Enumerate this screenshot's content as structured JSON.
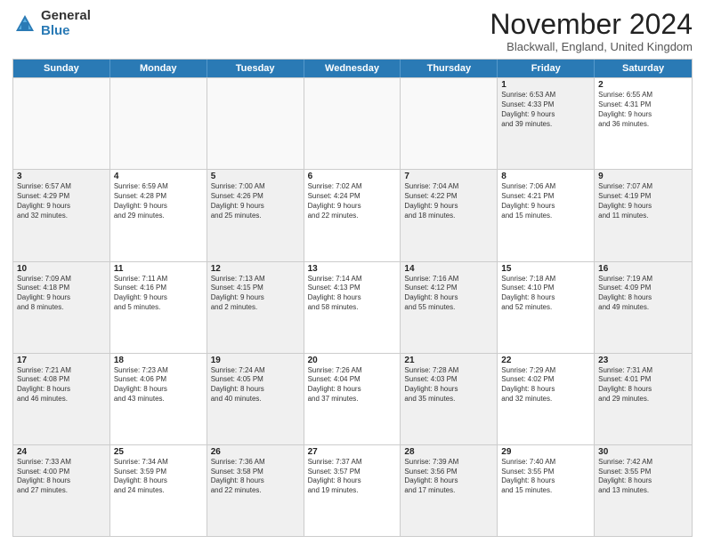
{
  "logo": {
    "general": "General",
    "blue": "Blue"
  },
  "header": {
    "month": "November 2024",
    "location": "Blackwall, England, United Kingdom"
  },
  "weekdays": [
    "Sunday",
    "Monday",
    "Tuesday",
    "Wednesday",
    "Thursday",
    "Friday",
    "Saturday"
  ],
  "rows": [
    [
      {
        "day": "",
        "text": "",
        "empty": true
      },
      {
        "day": "",
        "text": "",
        "empty": true
      },
      {
        "day": "",
        "text": "",
        "empty": true
      },
      {
        "day": "",
        "text": "",
        "empty": true
      },
      {
        "day": "",
        "text": "",
        "empty": true
      },
      {
        "day": "1",
        "text": "Sunrise: 6:53 AM\nSunset: 4:33 PM\nDaylight: 9 hours\nand 39 minutes.",
        "shaded": true
      },
      {
        "day": "2",
        "text": "Sunrise: 6:55 AM\nSunset: 4:31 PM\nDaylight: 9 hours\nand 36 minutes.",
        "shaded": false
      }
    ],
    [
      {
        "day": "3",
        "text": "Sunrise: 6:57 AM\nSunset: 4:29 PM\nDaylight: 9 hours\nand 32 minutes.",
        "shaded": true
      },
      {
        "day": "4",
        "text": "Sunrise: 6:59 AM\nSunset: 4:28 PM\nDaylight: 9 hours\nand 29 minutes.",
        "shaded": false
      },
      {
        "day": "5",
        "text": "Sunrise: 7:00 AM\nSunset: 4:26 PM\nDaylight: 9 hours\nand 25 minutes.",
        "shaded": true
      },
      {
        "day": "6",
        "text": "Sunrise: 7:02 AM\nSunset: 4:24 PM\nDaylight: 9 hours\nand 22 minutes.",
        "shaded": false
      },
      {
        "day": "7",
        "text": "Sunrise: 7:04 AM\nSunset: 4:22 PM\nDaylight: 9 hours\nand 18 minutes.",
        "shaded": true
      },
      {
        "day": "8",
        "text": "Sunrise: 7:06 AM\nSunset: 4:21 PM\nDaylight: 9 hours\nand 15 minutes.",
        "shaded": false
      },
      {
        "day": "9",
        "text": "Sunrise: 7:07 AM\nSunset: 4:19 PM\nDaylight: 9 hours\nand 11 minutes.",
        "shaded": true
      }
    ],
    [
      {
        "day": "10",
        "text": "Sunrise: 7:09 AM\nSunset: 4:18 PM\nDaylight: 9 hours\nand 8 minutes.",
        "shaded": true
      },
      {
        "day": "11",
        "text": "Sunrise: 7:11 AM\nSunset: 4:16 PM\nDaylight: 9 hours\nand 5 minutes.",
        "shaded": false
      },
      {
        "day": "12",
        "text": "Sunrise: 7:13 AM\nSunset: 4:15 PM\nDaylight: 9 hours\nand 2 minutes.",
        "shaded": true
      },
      {
        "day": "13",
        "text": "Sunrise: 7:14 AM\nSunset: 4:13 PM\nDaylight: 8 hours\nand 58 minutes.",
        "shaded": false
      },
      {
        "day": "14",
        "text": "Sunrise: 7:16 AM\nSunset: 4:12 PM\nDaylight: 8 hours\nand 55 minutes.",
        "shaded": true
      },
      {
        "day": "15",
        "text": "Sunrise: 7:18 AM\nSunset: 4:10 PM\nDaylight: 8 hours\nand 52 minutes.",
        "shaded": false
      },
      {
        "day": "16",
        "text": "Sunrise: 7:19 AM\nSunset: 4:09 PM\nDaylight: 8 hours\nand 49 minutes.",
        "shaded": true
      }
    ],
    [
      {
        "day": "17",
        "text": "Sunrise: 7:21 AM\nSunset: 4:08 PM\nDaylight: 8 hours\nand 46 minutes.",
        "shaded": true
      },
      {
        "day": "18",
        "text": "Sunrise: 7:23 AM\nSunset: 4:06 PM\nDaylight: 8 hours\nand 43 minutes.",
        "shaded": false
      },
      {
        "day": "19",
        "text": "Sunrise: 7:24 AM\nSunset: 4:05 PM\nDaylight: 8 hours\nand 40 minutes.",
        "shaded": true
      },
      {
        "day": "20",
        "text": "Sunrise: 7:26 AM\nSunset: 4:04 PM\nDaylight: 8 hours\nand 37 minutes.",
        "shaded": false
      },
      {
        "day": "21",
        "text": "Sunrise: 7:28 AM\nSunset: 4:03 PM\nDaylight: 8 hours\nand 35 minutes.",
        "shaded": true
      },
      {
        "day": "22",
        "text": "Sunrise: 7:29 AM\nSunset: 4:02 PM\nDaylight: 8 hours\nand 32 minutes.",
        "shaded": false
      },
      {
        "day": "23",
        "text": "Sunrise: 7:31 AM\nSunset: 4:01 PM\nDaylight: 8 hours\nand 29 minutes.",
        "shaded": true
      }
    ],
    [
      {
        "day": "24",
        "text": "Sunrise: 7:33 AM\nSunset: 4:00 PM\nDaylight: 8 hours\nand 27 minutes.",
        "shaded": true
      },
      {
        "day": "25",
        "text": "Sunrise: 7:34 AM\nSunset: 3:59 PM\nDaylight: 8 hours\nand 24 minutes.",
        "shaded": false
      },
      {
        "day": "26",
        "text": "Sunrise: 7:36 AM\nSunset: 3:58 PM\nDaylight: 8 hours\nand 22 minutes.",
        "shaded": true
      },
      {
        "day": "27",
        "text": "Sunrise: 7:37 AM\nSunset: 3:57 PM\nDaylight: 8 hours\nand 19 minutes.",
        "shaded": false
      },
      {
        "day": "28",
        "text": "Sunrise: 7:39 AM\nSunset: 3:56 PM\nDaylight: 8 hours\nand 17 minutes.",
        "shaded": true
      },
      {
        "day": "29",
        "text": "Sunrise: 7:40 AM\nSunset: 3:55 PM\nDaylight: 8 hours\nand 15 minutes.",
        "shaded": false
      },
      {
        "day": "30",
        "text": "Sunrise: 7:42 AM\nSunset: 3:55 PM\nDaylight: 8 hours\nand 13 minutes.",
        "shaded": true
      }
    ]
  ]
}
